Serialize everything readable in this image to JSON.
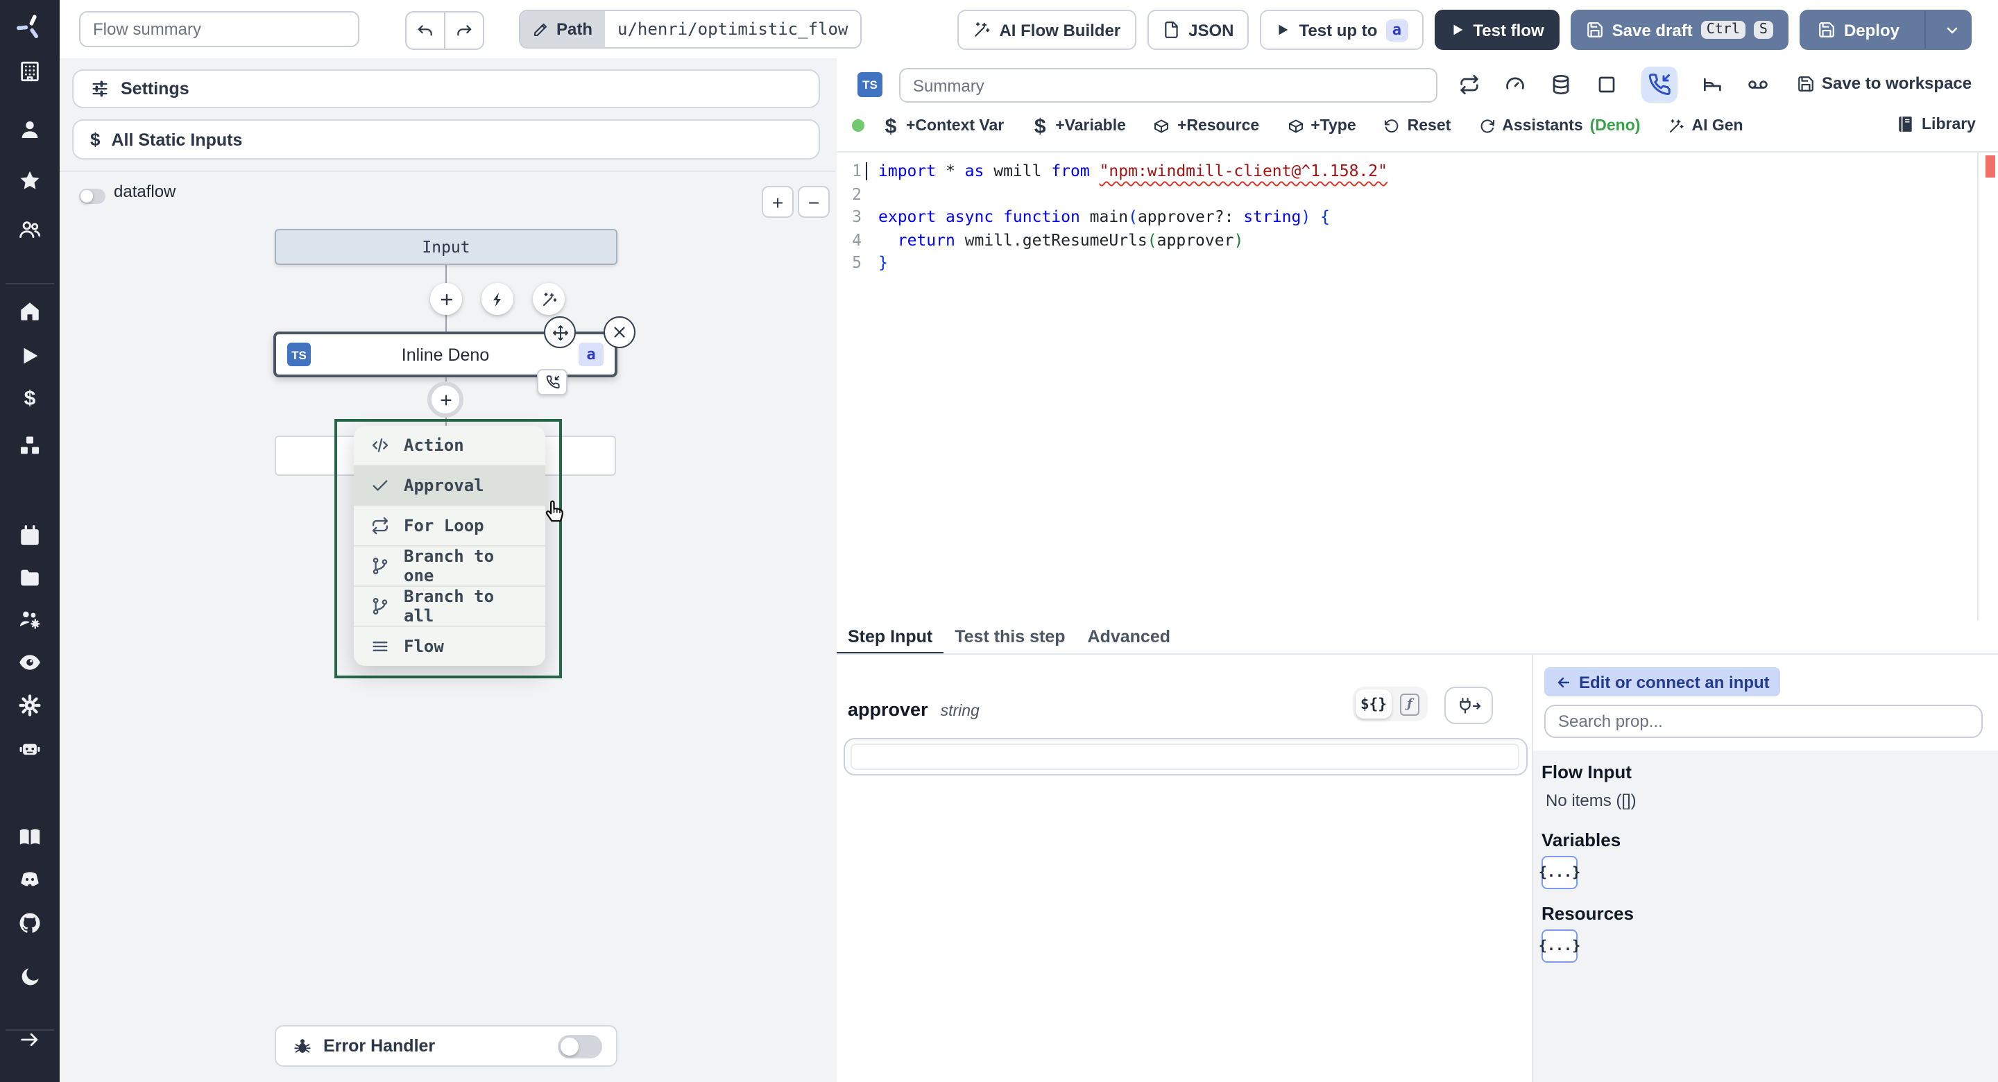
{
  "topbar": {
    "flow_summary_placeholder": "Flow summary",
    "path_label": "Path",
    "path_value": "u/henri/optimistic_flow",
    "ai_flow_builder": "AI Flow Builder",
    "json_button": "JSON",
    "test_up_to": "Test up to",
    "test_up_to_badge": "a",
    "test_flow": "Test flow",
    "save_draft": "Save draft",
    "save_draft_kbd": [
      "Ctrl",
      "S"
    ],
    "deploy": "Deploy"
  },
  "sidebar": {
    "items": [
      "building",
      "user",
      "star",
      "users",
      "home",
      "play",
      "dollar",
      "boxes",
      "calendar",
      "folder",
      "users-gear",
      "eye",
      "gear",
      "robot",
      "book",
      "discord",
      "github",
      "moon",
      "arrow-right"
    ]
  },
  "flow_panel": {
    "settings": "Settings",
    "all_static_inputs": "All Static Inputs",
    "dataflow_label": "dataflow",
    "dataflow_on": false,
    "zoom_in": "+",
    "zoom_out": "−",
    "input_node": "Input",
    "step_node": {
      "lang_badge": "TS",
      "title": "Inline Deno",
      "id_badge": "a"
    },
    "insert_menu": {
      "items": [
        {
          "label": "Action",
          "icon": "code",
          "active": false
        },
        {
          "label": "Approval",
          "icon": "check",
          "active": true
        },
        {
          "label": "For Loop",
          "icon": "repeat",
          "active": false
        },
        {
          "label": "Branch to one",
          "icon": "git-branch",
          "active": false
        },
        {
          "label": "Branch to all",
          "icon": "git-branch",
          "active": false
        },
        {
          "label": "Flow",
          "icon": "menu-lines",
          "active": false
        }
      ]
    },
    "error_handler": {
      "label": "Error Handler",
      "on": false
    }
  },
  "editor": {
    "lang_badge": "TS",
    "summary_placeholder": "Summary",
    "header_icons": [
      "repeat",
      "gauge",
      "database",
      "square",
      "phone-incoming",
      "bed",
      "voicemail"
    ],
    "header_active_icon": "phone-incoming",
    "save_to_workspace": "Save to workspace",
    "toolbar": {
      "status_dot_color": "#6fc96f",
      "chips": [
        {
          "label": "+Context Var",
          "icon": "dollar"
        },
        {
          "label": "+Variable",
          "icon": "dollar"
        },
        {
          "label": "+Resource",
          "icon": "package"
        },
        {
          "label": "+Type",
          "icon": "package"
        },
        {
          "label": "Reset",
          "icon": "rotate-ccw"
        },
        {
          "label": "Assistants",
          "suffix": "(Deno)",
          "icon": "refresh"
        },
        {
          "label": "AI Gen",
          "icon": "wand"
        }
      ],
      "library": "Library"
    },
    "code": {
      "lines": [
        {
          "n": "1",
          "tokens": [
            [
              "import ",
              "kw"
            ],
            [
              "* ",
              "pl"
            ],
            [
              "as",
              "kw"
            ],
            [
              " wmill ",
              "pl"
            ],
            [
              "from ",
              "kw"
            ],
            [
              "\"npm:windmill-client@^1.158.2\"",
              "str sq"
            ]
          ]
        },
        {
          "n": "2",
          "tokens": []
        },
        {
          "n": "3",
          "tokens": [
            [
              "export ",
              "kw"
            ],
            [
              "async ",
              "kw"
            ],
            [
              "function ",
              "kw"
            ],
            [
              "main",
              "fn"
            ],
            [
              "(",
              "b1"
            ],
            [
              "approver",
              "pl"
            ],
            [
              "?: ",
              "pl"
            ],
            [
              "string",
              "kw"
            ],
            [
              ")",
              "b1"
            ],
            [
              " {",
              "b1"
            ]
          ]
        },
        {
          "n": "4",
          "tokens": [
            [
              "  ",
              "pl"
            ],
            [
              "return ",
              "kw"
            ],
            [
              "wmill.",
              "pl"
            ],
            [
              "getResumeUrls",
              "fn"
            ],
            [
              "(",
              "b2"
            ],
            [
              "approver",
              "pl"
            ],
            [
              ")",
              "b2"
            ]
          ]
        },
        {
          "n": "5",
          "tokens": [
            [
              "}",
              "b1"
            ]
          ]
        }
      ]
    },
    "tabs": [
      {
        "label": "Step Input",
        "active": true
      },
      {
        "label": "Test this step",
        "active": false
      },
      {
        "label": "Advanced",
        "active": false
      }
    ]
  },
  "step_panel": {
    "prop_name": "approver",
    "prop_type": "string",
    "prop_value": "",
    "mode_json": "${}",
    "mode_fn": "ƒ"
  },
  "connect_panel": {
    "back_button": "Edit or connect an input",
    "search_placeholder": "Search prop...",
    "flow_input_title": "Flow Input",
    "flow_input_empty": "No items ([])",
    "variables_title": "Variables",
    "variables_button": "{...}",
    "resources_title": "Resources",
    "resources_button": "{...}"
  },
  "colors": {
    "accent_blue_button": "#63799e",
    "dark_button": "#2b3648",
    "menu_border_green": "#276749",
    "badge_indigo_bg": "#dbe1fb",
    "badge_indigo_text": "#2d3cc0",
    "active_icon_bg": "#d7e4fa",
    "error_marker": "#ee7066",
    "assistants_green": "#37a24a"
  },
  "icons_glyphs": {
    "undo-icon": "↶",
    "redo-icon": "↷",
    "plus-icon": "+",
    "minus-icon": "−",
    "close-icon": "×",
    "dollar-icon": "$"
  }
}
